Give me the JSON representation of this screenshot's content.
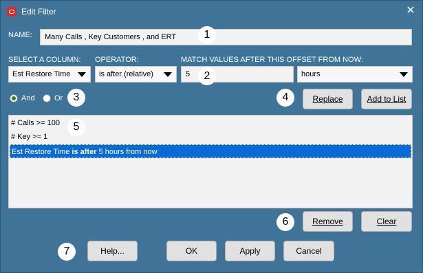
{
  "window": {
    "title": "Edit Filter",
    "close_glyph": "✕"
  },
  "name": {
    "label": "NAME:",
    "value": "Many Calls , Key Customers , and ERT"
  },
  "column": {
    "label": "SELECT A COLUMN:",
    "value": "Est Restore Time"
  },
  "operator": {
    "label": "OPERATOR:",
    "value": "is after (relative)"
  },
  "match": {
    "label": "MATCH VALUES AFTER THIS OFFSET FROM NOW:",
    "value": "5",
    "unit": "hours"
  },
  "logic": {
    "and_label": "And",
    "or_label": "Or",
    "selected": "And"
  },
  "buttons": {
    "replace": "Replace",
    "add_to_list": "Add to List",
    "remove": "Remove",
    "clear": "Clear",
    "help": "Help...",
    "ok": "OK",
    "apply": "Apply",
    "cancel": "Cancel"
  },
  "conditions": [
    {
      "text": "# Calls >= 100"
    },
    {
      "text": "# Key >= 1"
    },
    {
      "pre": "Est Restore Time ",
      "bold": "is after",
      "post": " 5 hours from now",
      "selected": true
    }
  ],
  "callouts": [
    "1",
    "2",
    "3",
    "4",
    "5",
    "6",
    "7"
  ],
  "colors": {
    "background": "#3f7398",
    "selection": "#0b6bd6",
    "radio_on": "#2e7d32"
  }
}
